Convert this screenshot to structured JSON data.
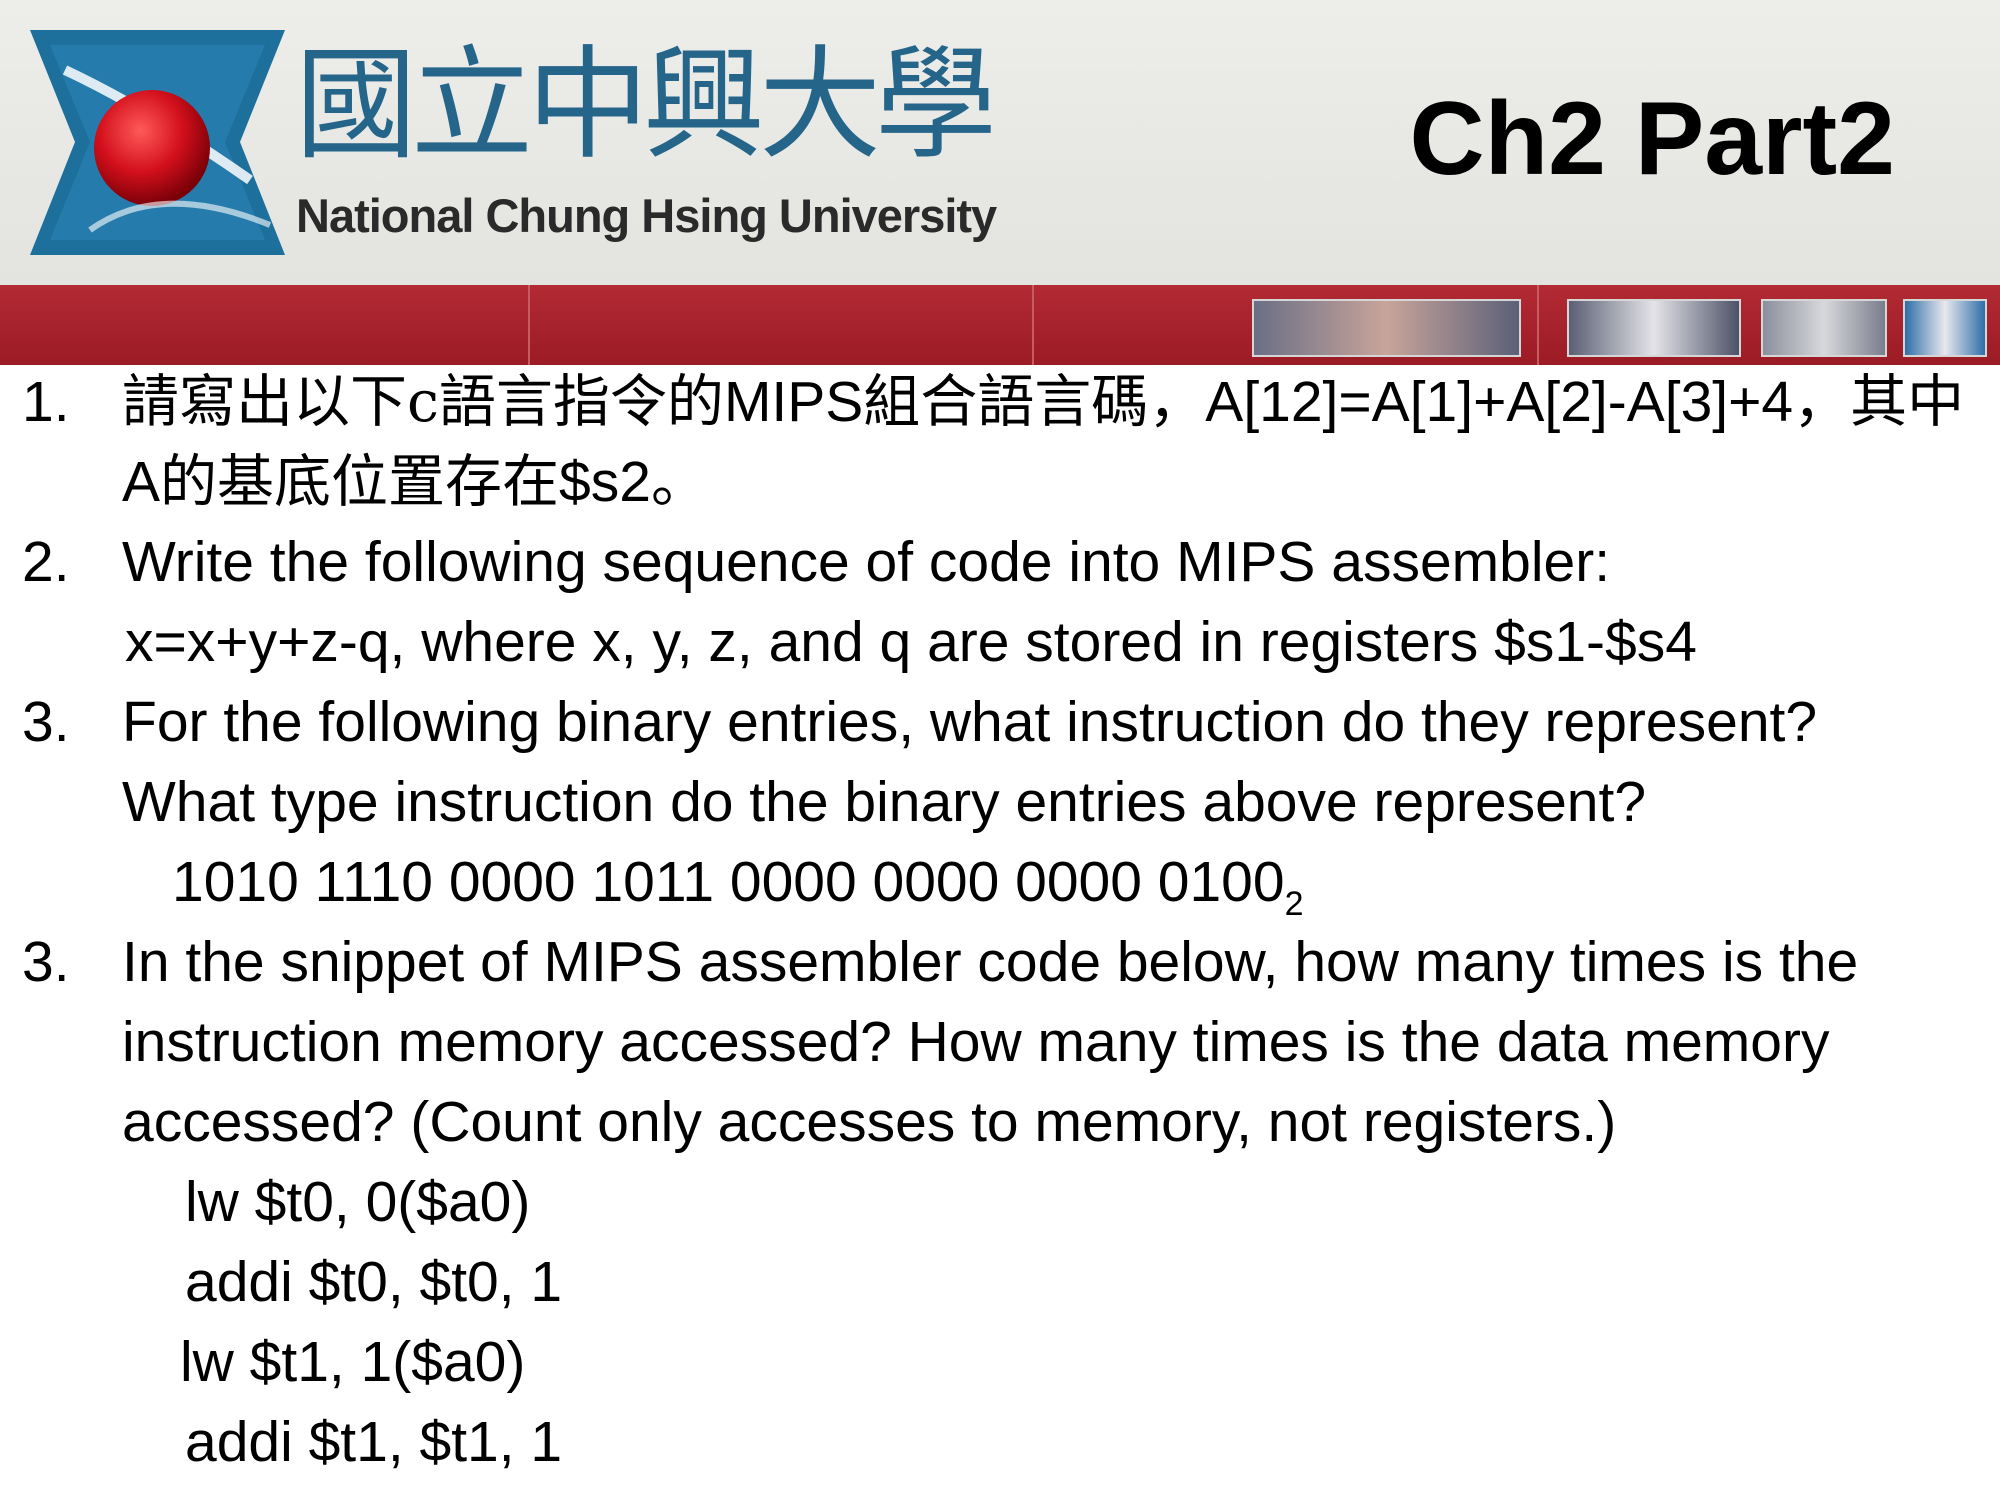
{
  "header": {
    "university_name_cn": "國立中興大學",
    "university_name_en": "National Chung Hsing University",
    "slide_title": "Ch2 Part2"
  },
  "colors": {
    "accent_red": "#9b1b25",
    "logo_blue": "#26658a",
    "logo_red": "#d3101c"
  },
  "questions": [
    {
      "number": "1.",
      "parts": [
        {
          "text": "請寫出以下c語言指令的",
          "cjk": true
        },
        {
          "text": "MIPS",
          "cjk": false
        },
        {
          "text": "組合語言碼，",
          "cjk": true
        },
        {
          "text": "A[12]=A[1]+A[2]-A[3]+4",
          "cjk": false
        },
        {
          "text": "，其中",
          "cjk": true
        },
        {
          "text": "A",
          "cjk": false
        },
        {
          "text": "的基底位置存在",
          "cjk": true
        },
        {
          "text": "$s2",
          "cjk": false
        },
        {
          "text": "。",
          "cjk": true
        }
      ]
    },
    {
      "number": "2.",
      "line1": "Write the following sequence of code into MIPS assembler:",
      "line2": "x=x+y+z-q, where x, y, z, and q are stored in registers $s1-$s4"
    },
    {
      "number": "3.",
      "line1": "For the following binary entries, what instruction do they represent?",
      "line2": "What type instruction do the binary entries above represent?",
      "binary": "1010 1110 0000 1011 0000 0000 0000 0100",
      "binary_subscript": "2"
    },
    {
      "number": "3.",
      "text": "In the snippet of MIPS assembler code below, how many times is the instruction memory accessed? How many times is the data memory accessed? (Count only accesses to memory, not registers.)",
      "code": [
        "lw $t0, 0($a0)",
        "addi $t0, $t0, 1",
        "lw $t1, 1($a0)",
        "addi $t1, $t1, 1"
      ]
    }
  ]
}
